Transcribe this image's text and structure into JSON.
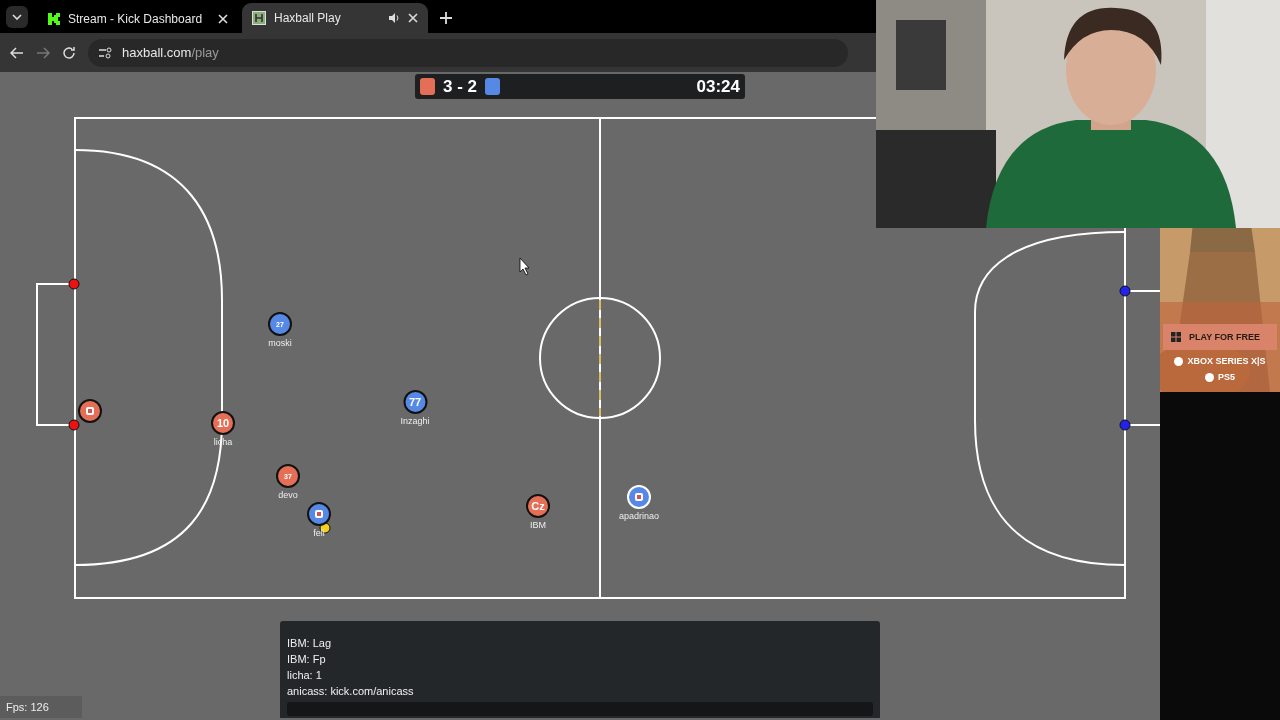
{
  "browser": {
    "tabs": [
      {
        "title": "Stream - Kick Dashboard",
        "selected": false,
        "audio": false
      },
      {
        "title": "Haxball Play",
        "selected": true,
        "audio": true
      }
    ],
    "url_host": "haxball.com",
    "url_path": "/play"
  },
  "scoreboard": {
    "score": "3 - 2",
    "time": "03:24"
  },
  "players": [
    {
      "color": "#e56e56"
    },
    {
      "color": "#e56e56",
      "number": "10",
      "name": "licha"
    },
    {
      "color": "#5689e5",
      "number": "27",
      "name": "moski"
    },
    {
      "color": "#5689e5",
      "number": "77",
      "name": "Inzaghi"
    },
    {
      "color": "#e56e56",
      "number": "37",
      "name": "devo"
    },
    {
      "color": "#5689e5",
      "name": "feli"
    },
    {
      "color": "#e56e56",
      "number": "Cz",
      "name": "IBM"
    },
    {
      "color": "#5689e5",
      "name": "apadrinao"
    }
  ],
  "ad": {
    "button": "PLAY FOR FREE",
    "platforms": [
      "XBOX SERIES X|S",
      "PS5"
    ]
  },
  "chat": {
    "messages": [
      "IBM: Lag",
      "IBM: Fp",
      "licha: 1",
      "anicass: kick.com/anicass"
    ]
  },
  "fps": "Fps: 126"
}
